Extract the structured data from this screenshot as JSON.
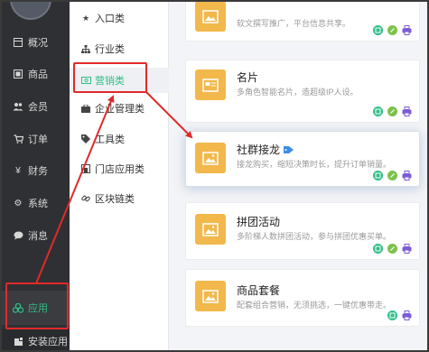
{
  "sidebar": {
    "items": [
      {
        "label": "概况",
        "icon": "table-icon"
      },
      {
        "label": "商品",
        "icon": "box-icon"
      },
      {
        "label": "会员",
        "icon": "users-icon"
      },
      {
        "label": "订单",
        "icon": "cart-icon"
      },
      {
        "label": "财务",
        "icon": "yen-icon"
      },
      {
        "label": "系统",
        "icon": "gear-icon"
      },
      {
        "label": "消息",
        "icon": "chat-icon"
      },
      {
        "label": "应用",
        "icon": "apps-icon"
      },
      {
        "label": "安装应用",
        "icon": "install-icon"
      }
    ],
    "active": "应用"
  },
  "submenu": {
    "items": [
      {
        "label": "入口类",
        "icon": "star-icon"
      },
      {
        "label": "行业类",
        "icon": "sitemap-icon"
      },
      {
        "label": "营销类",
        "icon": "money-icon"
      },
      {
        "label": "企业管理类",
        "icon": "briefcase-icon"
      },
      {
        "label": "工具类",
        "icon": "tag-icon"
      },
      {
        "label": "门店应用类",
        "icon": "store-icon"
      },
      {
        "label": "区块链类",
        "icon": "link-icon"
      }
    ],
    "active": "营销类"
  },
  "cards": [
    {
      "title": "",
      "desc": "软文撰写推广，平台信息共享。"
    },
    {
      "title": "名片",
      "desc": "多角色智能名片，造超级IP人设。"
    },
    {
      "title": "社群接龙",
      "desc": "接龙购买，缩短决策时长，提升订单销量。"
    },
    {
      "title": "拼团活动",
      "desc": "多阶梯人数拼团活动，参与拼团优惠买单。"
    },
    {
      "title": "商品套餐",
      "desc": "配套组合营销，无须挑选，一键优惠带走。"
    }
  ],
  "colors": {
    "sidebar_bg": "#2f3033",
    "accent_green": "#2fbe87",
    "thumb_orange": "#f2b84b",
    "highlight_red": "#e02a2a",
    "print_purple": "#7b5cd6"
  }
}
